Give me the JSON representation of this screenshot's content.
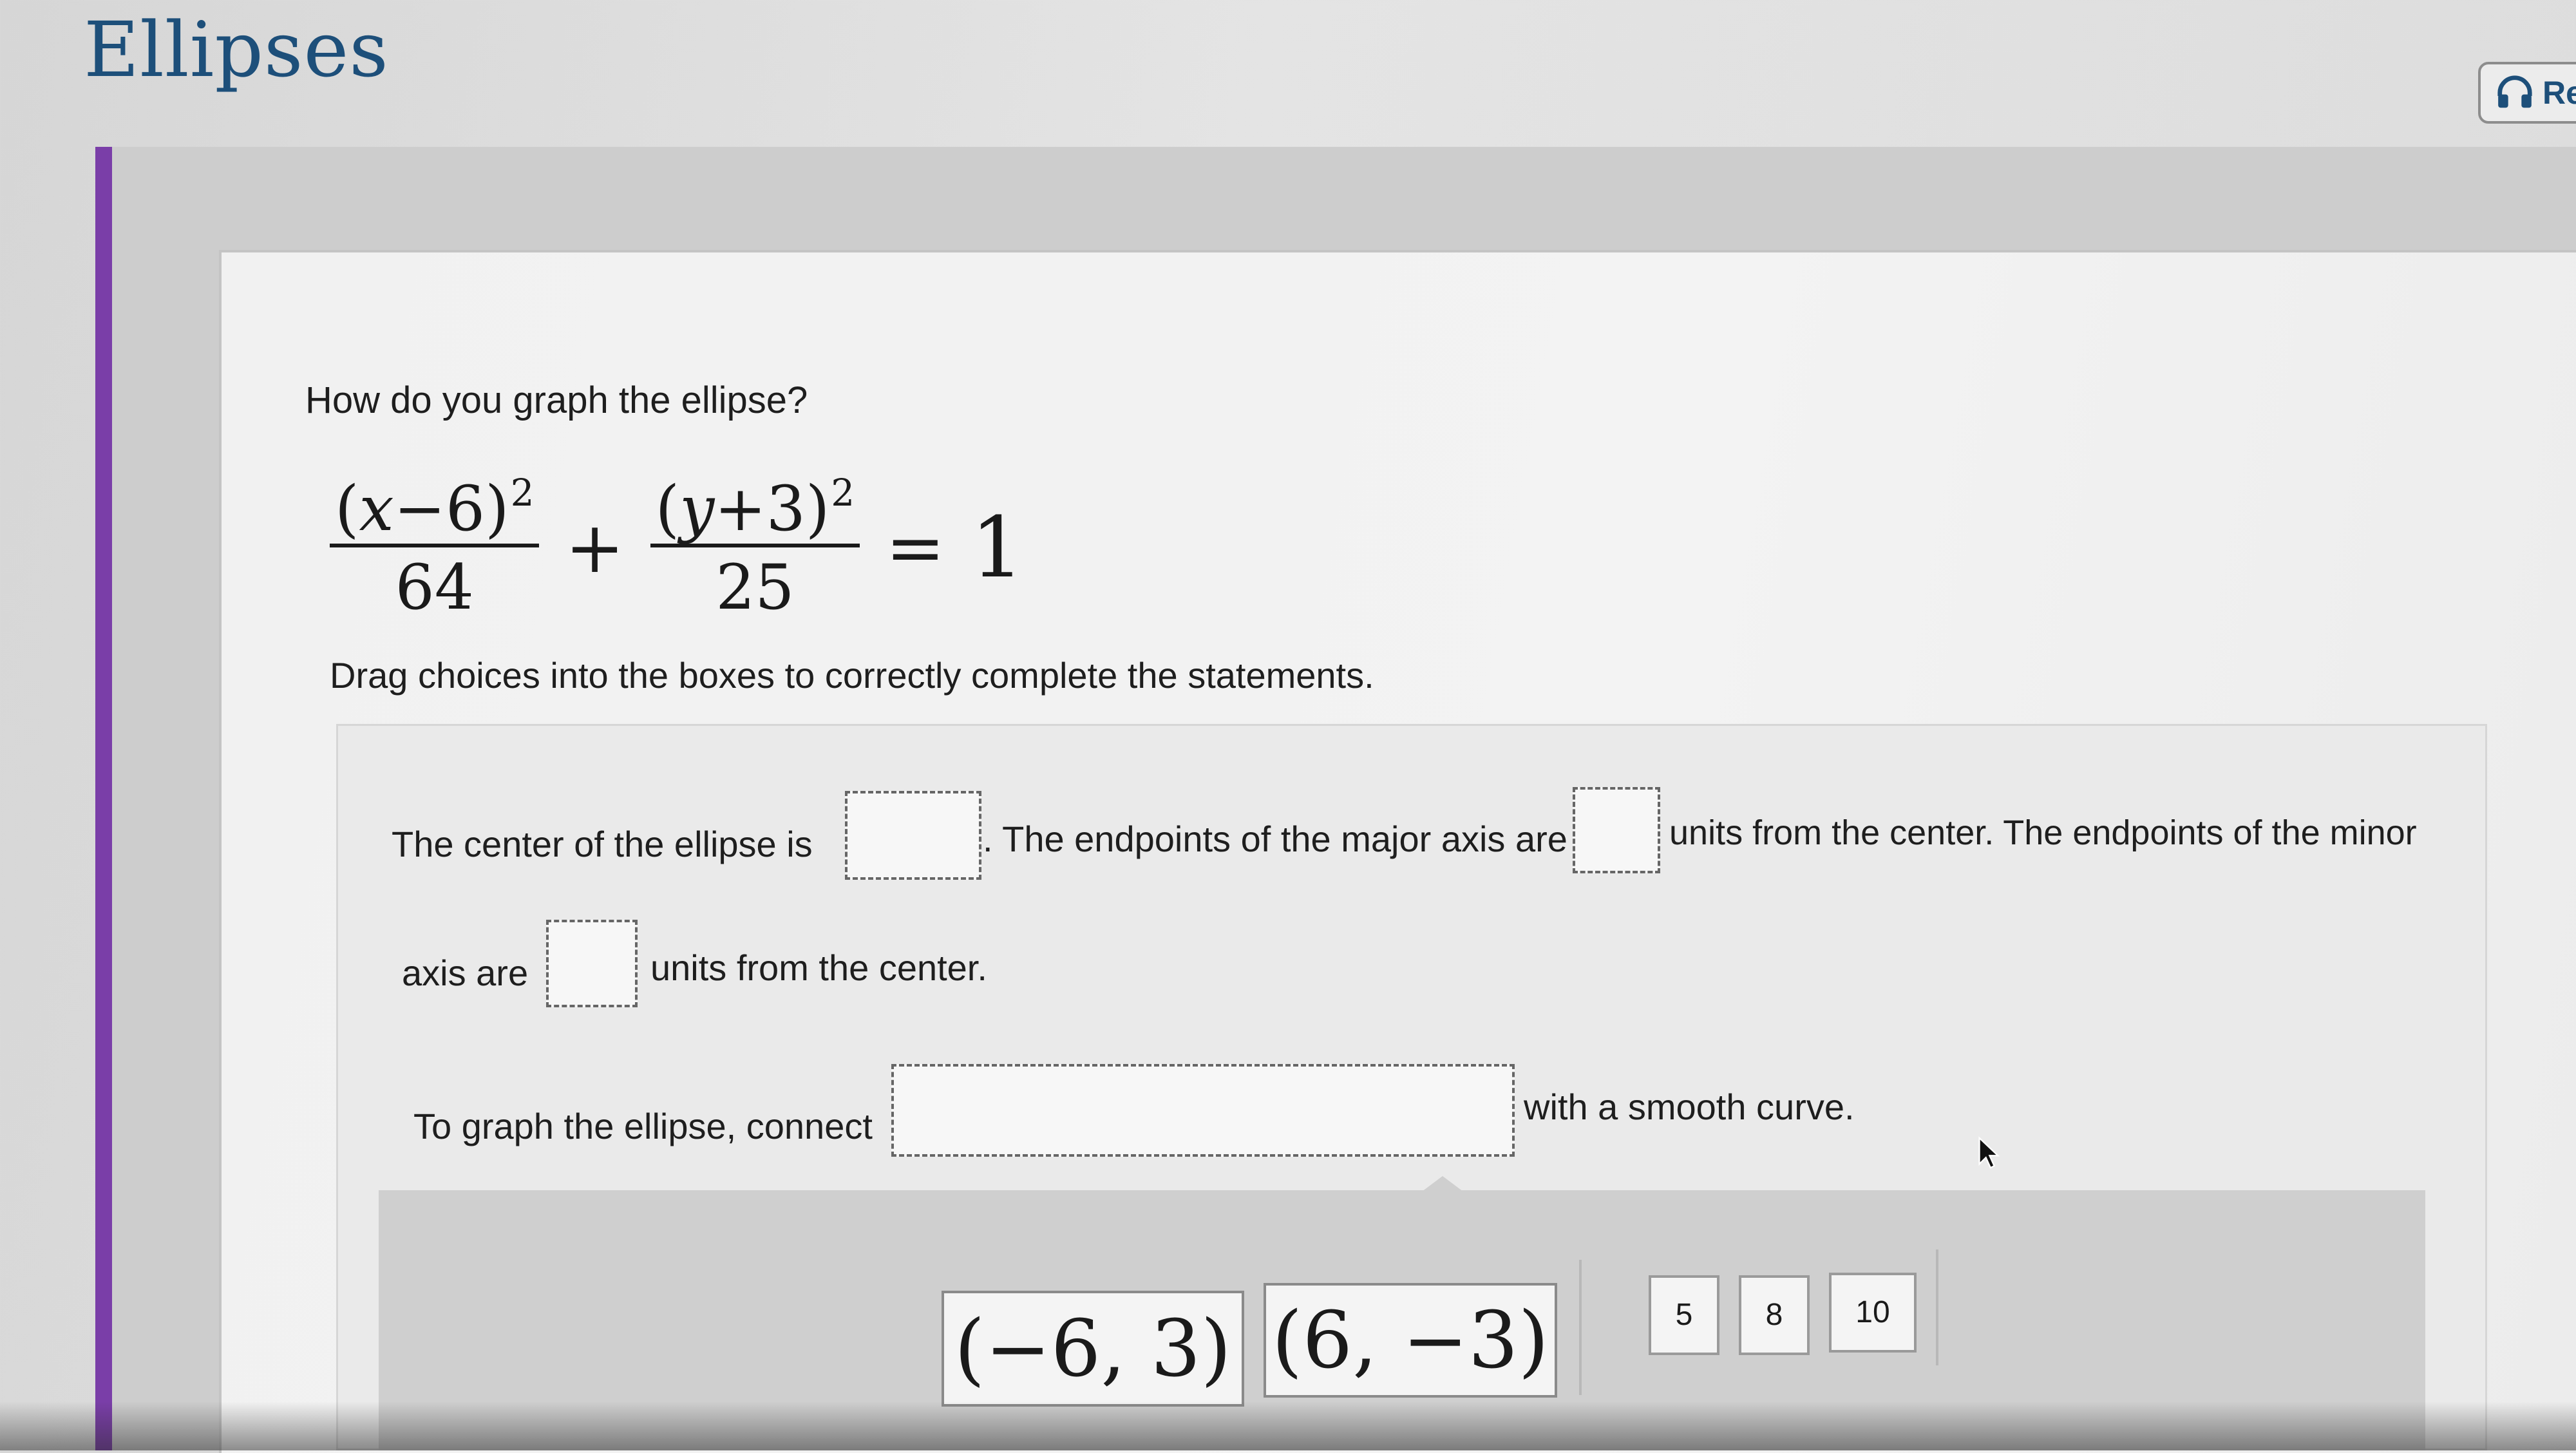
{
  "header": {
    "title": "Ellipses",
    "read_button_label": "Rea"
  },
  "question": {
    "prompt": "How do you graph the ellipse?",
    "equation": {
      "term1_num_var": "x",
      "term1_num_op": "−6",
      "term1_num_exp": "2",
      "term1_den": "64",
      "plus": "+",
      "term2_num_var": "y",
      "term2_num_op": "+3",
      "term2_num_exp": "2",
      "term2_den": "25",
      "equals": "=",
      "rhs": "1"
    },
    "instruction": "Drag choices into the boxes to correctly complete the statements."
  },
  "statements": {
    "center_prefix": "The center of the ellipse is",
    "major_prefix": ". The endpoints of the major axis are",
    "major_suffix": "units from the center. The endpoints of the minor",
    "minor_prefix": "axis are",
    "minor_suffix": "units from the center.",
    "graph_prefix": "To graph the ellipse, connect",
    "graph_suffix": "with a smooth curve."
  },
  "choices": {
    "points": [
      "(−6, 3)",
      "(6, −3)"
    ],
    "numbers": [
      "5",
      "8",
      "10"
    ]
  },
  "colors": {
    "accent": "#7a3ea8",
    "title": "#1d4f7a"
  },
  "icons": {
    "read_icon": "headphones-icon",
    "cursor": "mouse-pointer-icon"
  }
}
